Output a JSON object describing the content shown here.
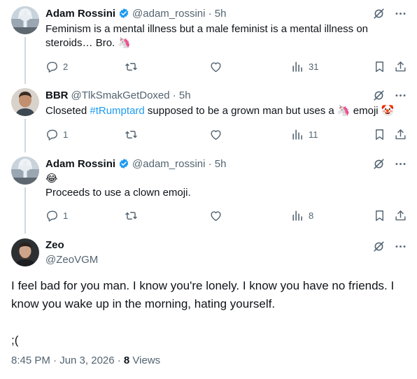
{
  "replies": [
    {
      "name": "Adam Rossini",
      "handle": "@adam_rossini · 5h",
      "verified": true,
      "text_lines": [
        "Feminism is a mental illness but a male feminist is a mental illness on",
        "steroids… Bro. 🦄"
      ],
      "reply_count": "2",
      "retweet_count": "",
      "like_count": "",
      "view_count": "31"
    },
    {
      "name": "BBR",
      "handle": "@TlkSmakGetDoxed · 5h",
      "verified": false,
      "text_before": "Closeted ",
      "hashtag": "#tRumptard",
      "text_after": " supposed to be a grown man but uses a 🦄 emoji 🤡",
      "reply_count": "1",
      "retweet_count": "",
      "like_count": "",
      "view_count": "11"
    },
    {
      "name": "Adam Rossini",
      "handle": "@adam_rossini · 5h",
      "verified": true,
      "text_lines": [
        "😂",
        "Proceeds to use a clown emoji."
      ],
      "reply_count": "1",
      "retweet_count": "",
      "like_count": "",
      "view_count": "8"
    }
  ],
  "main": {
    "name": "Zeo",
    "handle": "@ZeoVGM",
    "text_lines": [
      "I feel bad for you man. I know you're lonely. I know you have no friends. I",
      "know you wake up in the morning, hating yourself.",
      "",
      ";("
    ],
    "timestamp": "8:45 PM · Jun 3, 2026 · ",
    "views_count": "8",
    "views_label": " Views"
  },
  "icons": {
    "grok": "grok-icon",
    "more": "more-icon",
    "reply": "reply-icon",
    "retweet": "retweet-icon",
    "like": "like-icon",
    "views": "views-icon",
    "bookmark": "bookmark-icon",
    "share": "share-icon",
    "verified": "verified-badge-icon"
  },
  "colors": {
    "text": "#0f1419",
    "secondary": "#536471",
    "accent": "#1d9bf0",
    "thread_line": "#cfd9de"
  }
}
